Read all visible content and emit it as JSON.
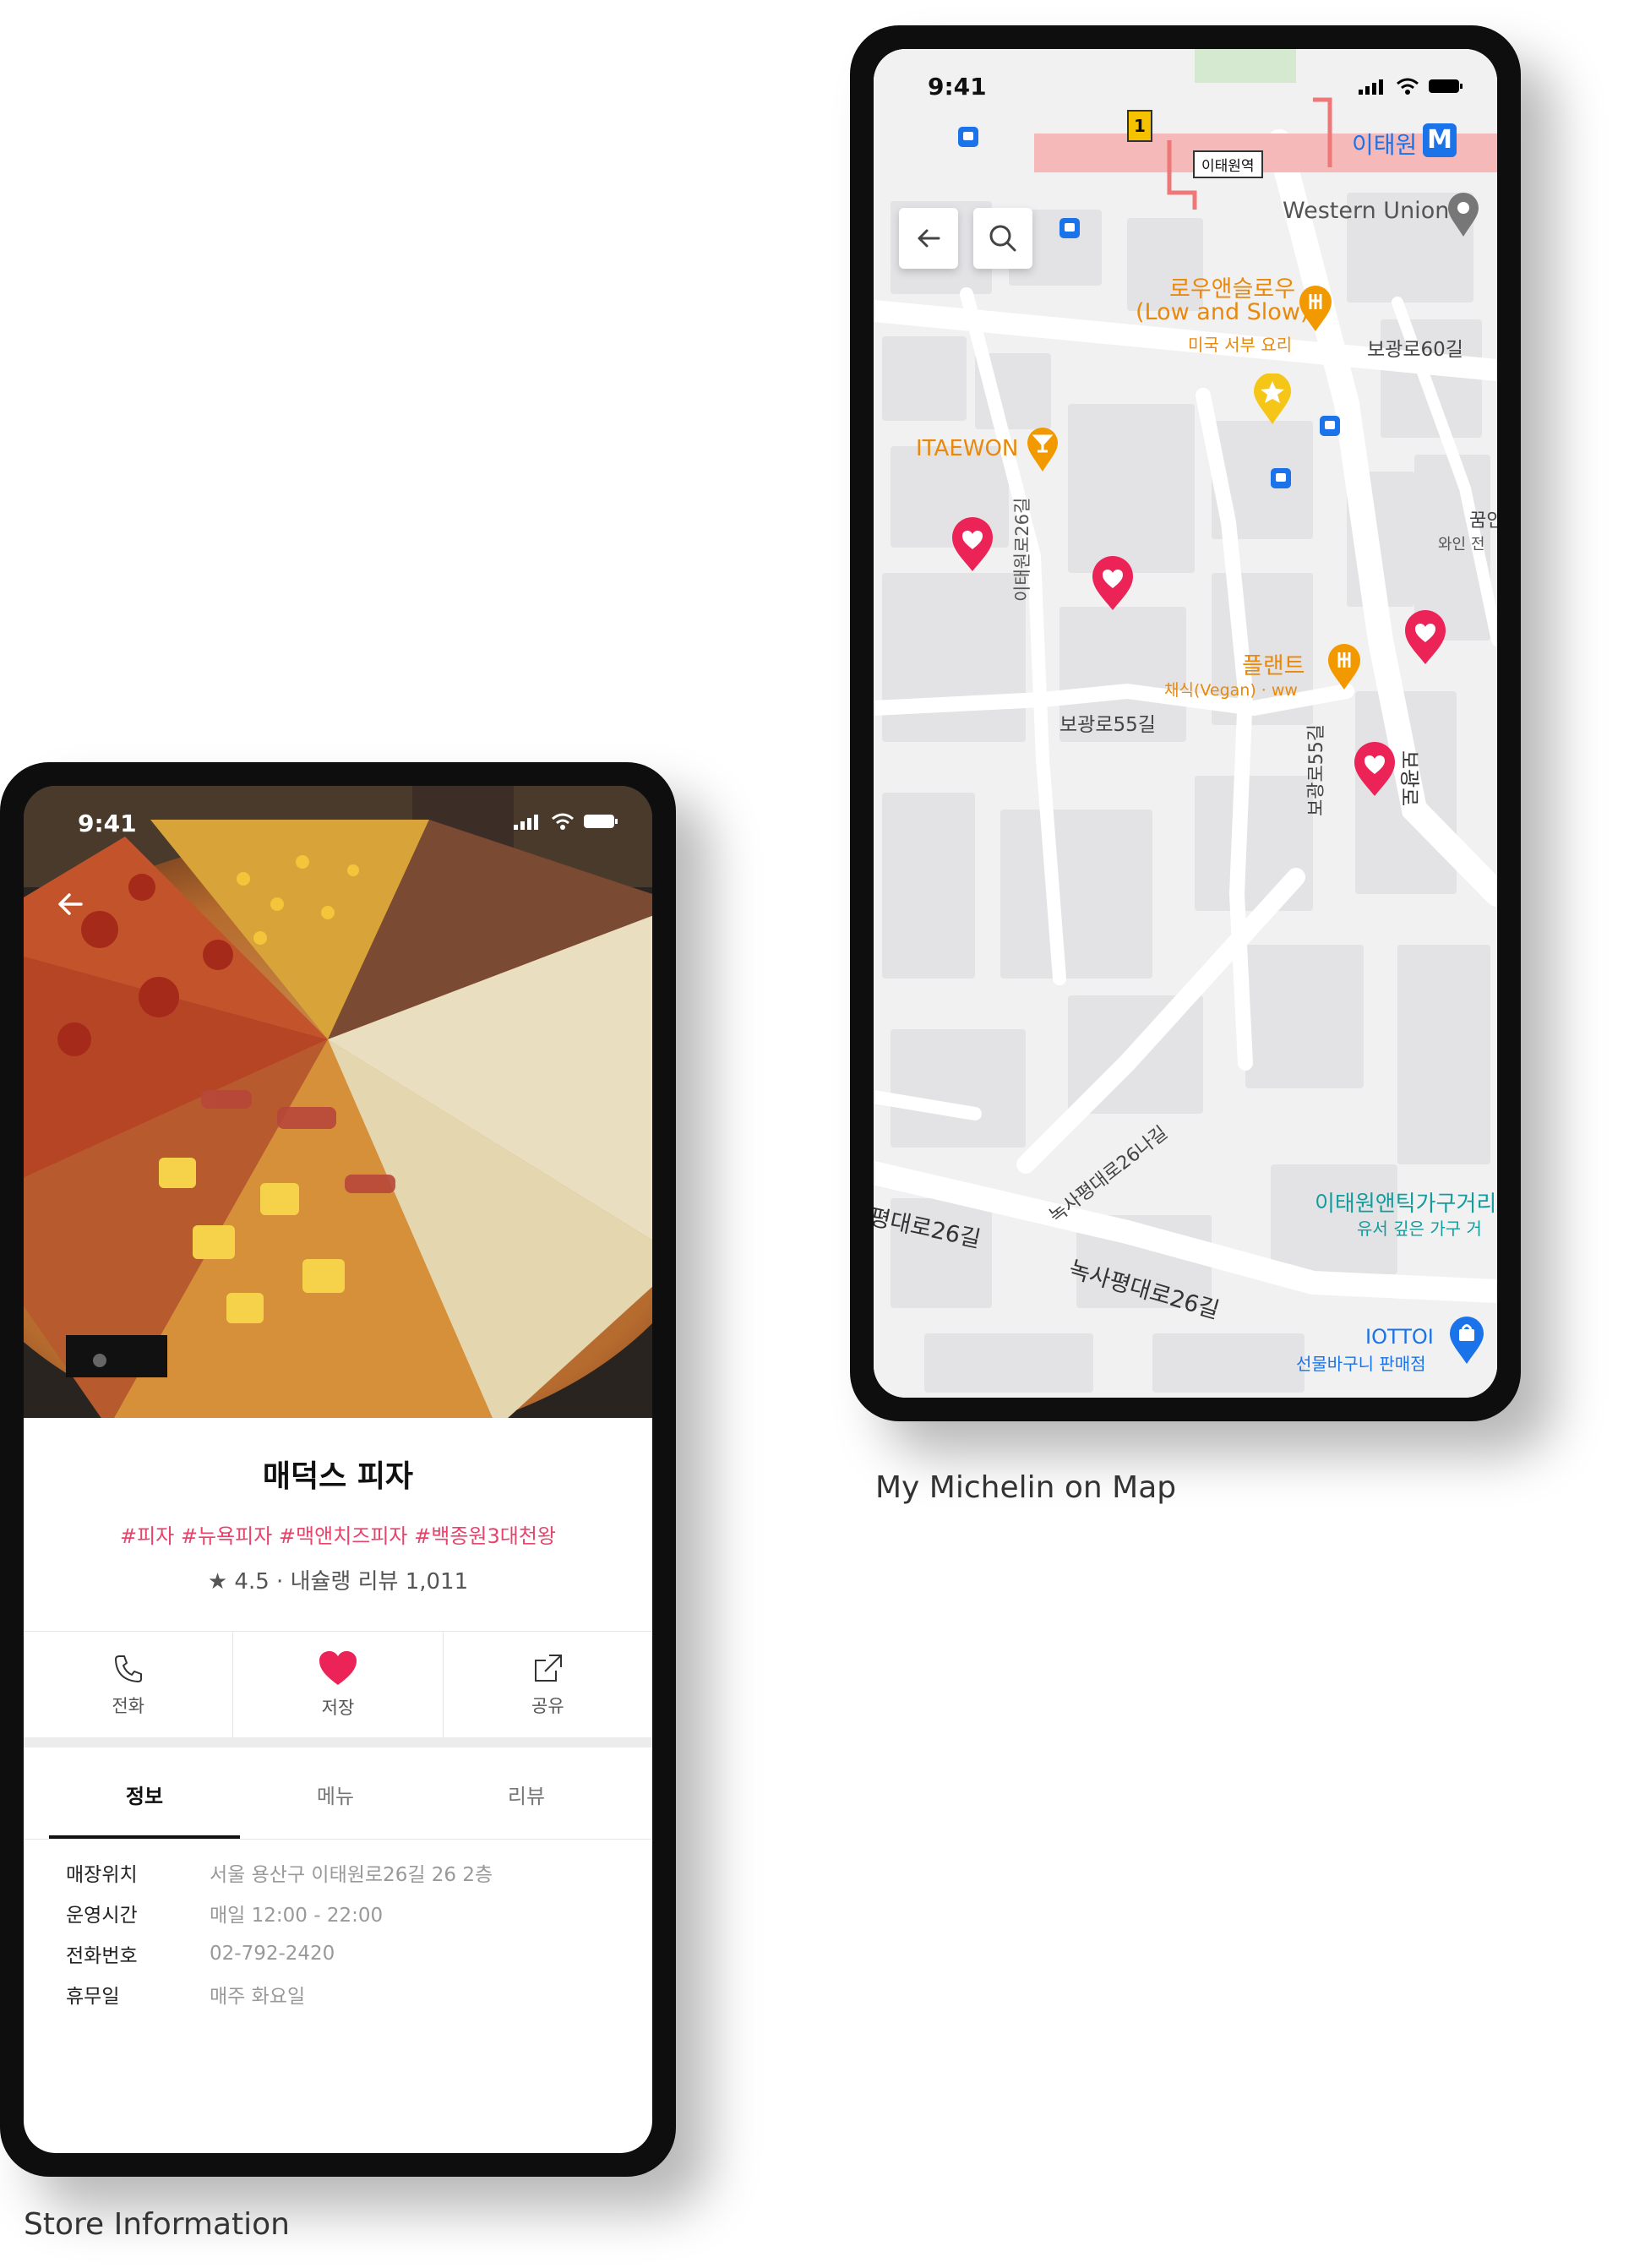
{
  "store_screen": {
    "status": {
      "time": "9:41"
    },
    "store": {
      "name": "매덕스 피자",
      "tags": "#피자 #뉴욕피자 #맥앤치즈피자 #백종원3대천왕",
      "rating": "★ 4.5 · 내슐랭 리뷰 1,011"
    },
    "actions": [
      {
        "label": "전화",
        "icon": "phone-icon"
      },
      {
        "label": "저장",
        "icon": "heart-icon"
      },
      {
        "label": "공유",
        "icon": "share-icon"
      }
    ],
    "tabs": [
      {
        "label": "정보",
        "active": true
      },
      {
        "label": "메뉴",
        "active": false
      },
      {
        "label": "리뷰",
        "active": false
      }
    ],
    "info": [
      {
        "key": "매장위치",
        "value": "서울 용산구 이태원로26길 26 2층"
      },
      {
        "key": "운영시간",
        "value": "매일 12:00 - 22:00"
      },
      {
        "key": "전화번호",
        "value": "02-792-2420"
      },
      {
        "key": "휴무일",
        "value": "매주 화요일"
      }
    ],
    "caption": "Store Information"
  },
  "map_screen": {
    "status": {
      "time": "9:41"
    },
    "labels": {
      "station": "이태원",
      "station_sign": "이태원역",
      "western_union": "Western Union",
      "low_and_slow_ko": "로우앤슬로우",
      "low_and_slow_en": "(Low and Slow)",
      "low_and_slow_sub": "미국 서부 요리",
      "road_60": "보광로60길",
      "itaewon": "ITAEWON",
      "kkum": "꿈인",
      "wine": "와인 전",
      "itaewonro26": "이태원로26길",
      "plant": "플랜트",
      "plant_sub": "채식(Vegan) · ww",
      "road_55": "보광로55길",
      "road_55_v": "보광로55길",
      "bogwangro": "보광로",
      "noksa26na": "녹사평대로26나길",
      "antique": "이태원앤틱가구거리",
      "antique_sub": "유서 깊은 가구 거",
      "noksa26_left": "평대로26길",
      "noksa26": "녹사평대로26길",
      "iottoi": "IOTTOI",
      "iottoi_sub": "선물바구니 판매점",
      "exit_number": "1",
      "metro_badge": "M"
    },
    "caption": "My Michelin on Map"
  },
  "colors": {
    "accent_pink": "#e8436b",
    "heart_red": "#ec2357",
    "map_orange": "#e8890c",
    "map_blue": "#1a73e8"
  }
}
